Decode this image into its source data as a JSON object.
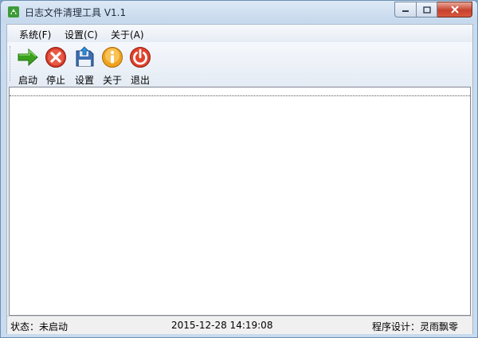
{
  "window": {
    "title": "日志文件清理工具 V1.1"
  },
  "menu": [
    {
      "label": "系统(F)"
    },
    {
      "label": "设置(C)"
    },
    {
      "label": "关于(A)"
    }
  ],
  "toolbar": {
    "start_label": "启动",
    "stop_label": "停止",
    "settings_label": "设置",
    "about_label": "关于",
    "exit_label": "退出",
    "icons": [
      "arrow-right-icon",
      "stop-icon",
      "settings-icon",
      "info-icon",
      "power-icon"
    ]
  },
  "status": {
    "state": "状态：未启动",
    "datetime": "2015-12-28  14:19:08",
    "author": "程序设计：灵雨飘零"
  },
  "colors": {
    "close_red": "#c7412c",
    "start_green": "#3aa01e",
    "stop_red": "#d63a2a",
    "info_orange": "#f0a21c",
    "exit_red": "#e2412b"
  }
}
